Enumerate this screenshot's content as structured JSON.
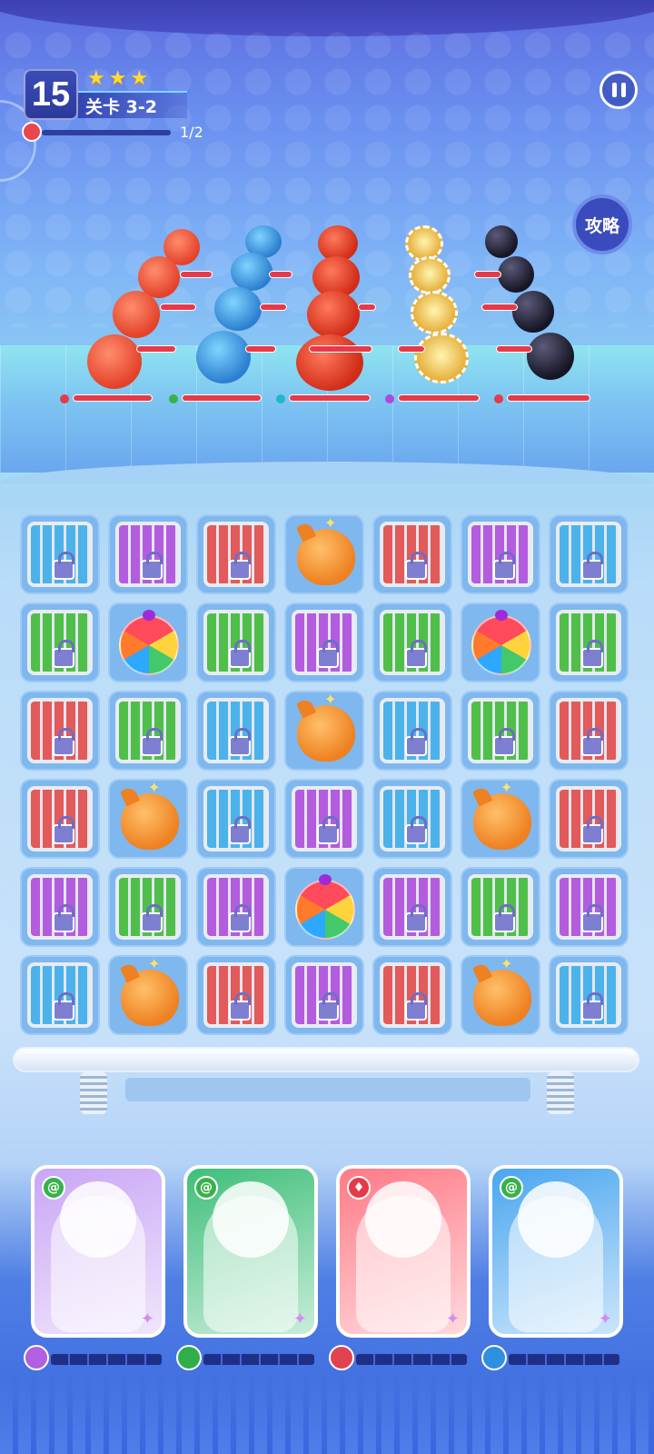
{
  "header": {
    "level_number": "15",
    "stars": [
      "★",
      "★",
      "★"
    ],
    "stage_label": "关卡 3-2",
    "progress_text": "1/2",
    "pause_icon": "pause-icon",
    "guide_label": "攻略"
  },
  "enemy_groups": [
    {
      "type": "red-fish",
      "count": 4
    },
    {
      "type": "blue-jellyfish",
      "count": 4
    },
    {
      "type": "red-crab",
      "count": 4
    },
    {
      "type": "spiked-shell",
      "count": 4
    },
    {
      "type": "bomb",
      "count": 4
    }
  ],
  "board": {
    "rows": [
      [
        "cage-blue",
        "cage-purple",
        "cage-red",
        "bomb",
        "cage-red",
        "cage-purple",
        "cage-blue"
      ],
      [
        "cage-green",
        "ball",
        "cage-green",
        "cage-purple",
        "cage-green",
        "ball",
        "cage-green"
      ],
      [
        "cage-red",
        "cage-green",
        "cage-blue",
        "bomb",
        "cage-blue",
        "cage-green",
        "cage-red"
      ],
      [
        "cage-red",
        "bomb",
        "cage-blue",
        "cage-purple",
        "cage-blue",
        "bomb",
        "cage-red"
      ],
      [
        "cage-purple",
        "cage-green",
        "cage-purple",
        "ball",
        "cage-purple",
        "cage-green",
        "cage-purple"
      ],
      [
        "cage-blue",
        "bomb",
        "cage-red",
        "cage-purple",
        "cage-red",
        "bomb",
        "cage-blue"
      ]
    ]
  },
  "heroes": [
    {
      "name": "green-knight",
      "element": "wind",
      "bg": "#c9a6f5"
    },
    {
      "name": "pilot-dog",
      "element": "wind",
      "bg": "#3fbf7a"
    },
    {
      "name": "tennis-girl",
      "element": "fire",
      "bg": "#ff7a86"
    },
    {
      "name": "astronaut-bear",
      "element": "wind",
      "bg": "#4aa6f0"
    }
  ],
  "colors": {
    "accent": "#3a4bbd",
    "hp_bar": "#e53a4a",
    "star": "#ffd93a"
  }
}
